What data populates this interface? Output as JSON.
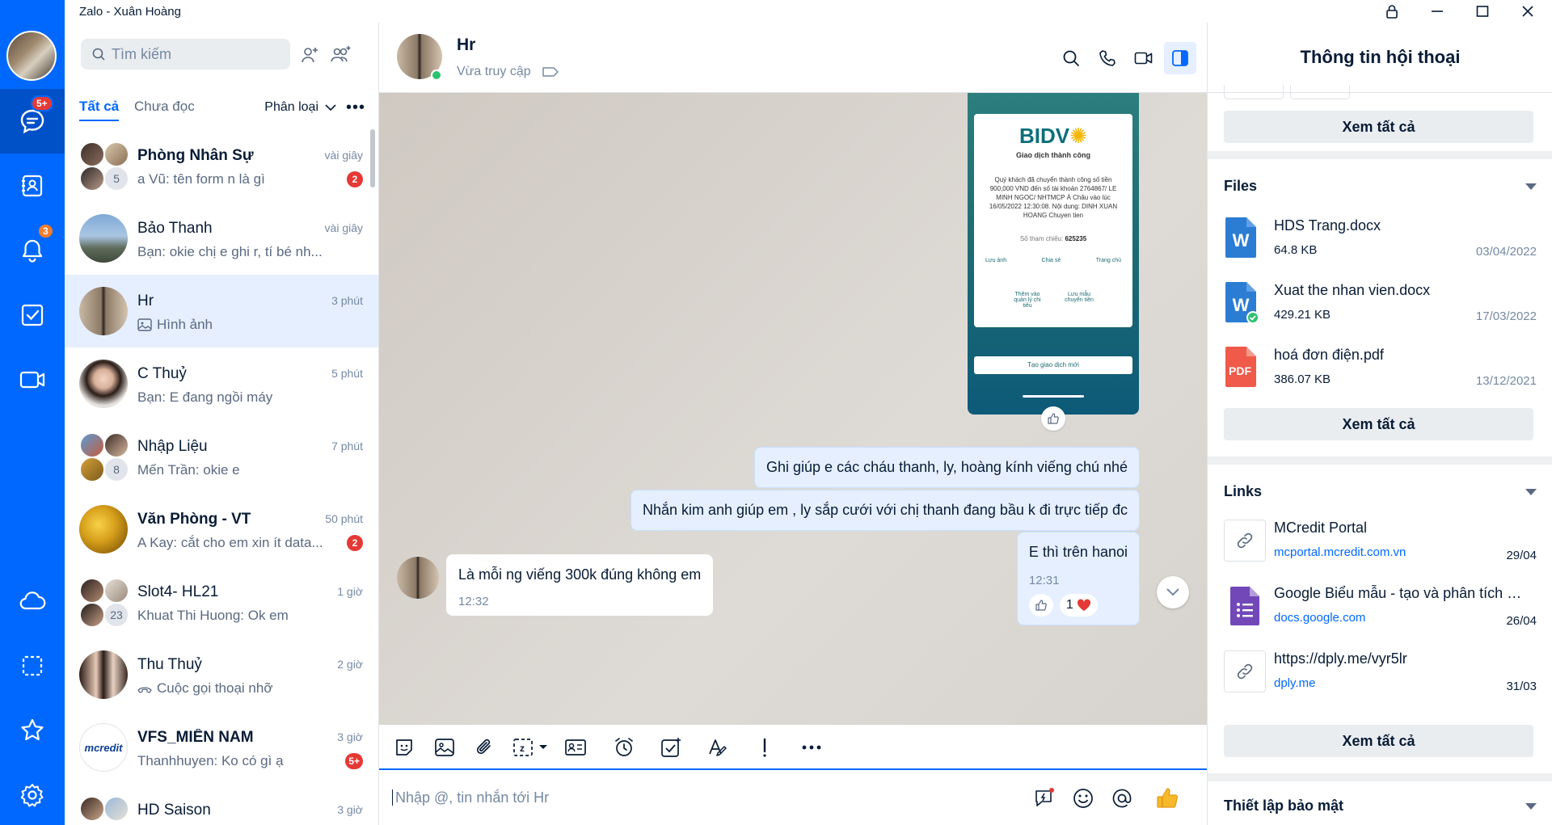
{
  "window": {
    "title": "Zalo - Xuân Hoàng"
  },
  "nav": {
    "chat_badge": "5+",
    "notif_badge": "3"
  },
  "list": {
    "search_placeholder": "Tìm kiếm",
    "tab_all": "Tất cả",
    "tab_unread": "Chưa đọc",
    "filter_label": "Phân loại",
    "more": "•••",
    "conversations": [
      {
        "name": "Phòng Nhân Sự",
        "time": "vài giây",
        "preview": "a Vũ: tên form n là gì",
        "badge": "2",
        "group_count": "5"
      },
      {
        "name": "Bảo Thanh",
        "time": "vài giây",
        "preview": "Bạn: okie chị e ghi r, tí bé nh..."
      },
      {
        "name": "Hr",
        "time": "3 phút",
        "preview": "Hình ảnh"
      },
      {
        "name": "C Thuỷ",
        "time": "5 phút",
        "preview": "Bạn: E đang ngồi máy"
      },
      {
        "name": "Nhập Liệu",
        "time": "7 phút",
        "preview": "Mến Trần: okie e",
        "group_count": "8"
      },
      {
        "name": "Văn Phòng - VT",
        "time": "50 phút",
        "preview": "A Kay: cắt cho em xin ít data...",
        "badge": "2"
      },
      {
        "name": "Slot4- HL21",
        "time": "1 giờ",
        "preview": "Khuat Thi Huong: Ok em",
        "group_count": "23"
      },
      {
        "name": "Thu Thuỷ",
        "time": "2 giờ",
        "preview": "Cuộc gọi thoại nhỡ"
      },
      {
        "name": "VFS_MIỀN NAM",
        "time": "3 giờ",
        "preview": "Thanhhuyen: Ko có gì ạ",
        "badge": "5+",
        "logo_text": "mcredit"
      },
      {
        "name": "HD Saison",
        "time": "3 giờ",
        "preview": ""
      }
    ]
  },
  "chat": {
    "name": "Hr",
    "status": "Vừa truy cập",
    "receipt": {
      "bank": "BIDV",
      "subtitle": "Giao dịch thành công",
      "body": "Quý khách đã chuyển thành công số tiền 900,000 VND đến số tài khoản 2764867/ LE MINH NGOC/ NHTMCP Á Châu vào lúc 16/05/2022 12:30:08. Nội dung: DINH XUAN HOANG Chuyen tien",
      "ref_label": "Số tham chiếu:",
      "ref_value": "625235",
      "action1": "Lưu ảnh",
      "action2": "Chia sẻ",
      "action3": "Trang chủ",
      "action4": "Thêm vào quản lý chi tiêu",
      "action5": "Lưu mẫu chuyển tiền",
      "new_tx": "Tạo giao dịch mới"
    },
    "messages": [
      {
        "text": "Ghi giúp e các cháu thanh, ly, hoàng kính viếng chú nhé"
      },
      {
        "text": "Nhắn kim anh giúp em , ly sắp cưới với chị thanh đang bầu k đi trực tiếp đc"
      },
      {
        "text": "E thì trên hanoi",
        "time": "12:31",
        "reaction_count": "1"
      },
      {
        "text": "Là mỗi ng viếng 300k đúng không em",
        "time": "12:32"
      }
    ],
    "input_placeholder": "Nhập @, tin nhắn tới Hr"
  },
  "info": {
    "title": "Thông tin hội thoại",
    "see_all": "Xem tất cả",
    "files_title": "Files",
    "files": [
      {
        "name": "HDS Trang.docx",
        "size": "64.8 KB",
        "date": "03/04/2022",
        "type": "W"
      },
      {
        "name": "Xuat the nhan vien.docx",
        "size": "429.21 KB",
        "date": "17/03/2022",
        "type": "W"
      },
      {
        "name": "hoá đơn điện.pdf",
        "size": "386.07 KB",
        "date": "13/12/2021",
        "type": "PDF"
      }
    ],
    "links_title": "Links",
    "links": [
      {
        "title": "MCredit Portal",
        "domain": "mcportal.mcredit.com.vn",
        "date": "29/04"
      },
      {
        "title": "Google Biểu mẫu - tạo và phân tích bả...",
        "domain": "docs.google.com",
        "date": "26/04"
      },
      {
        "title": "https://dply.me/vyr5lr",
        "domain": "dply.me",
        "date": "31/03"
      }
    ],
    "security_title": "Thiết lập bảo mật"
  },
  "colors": {
    "brand": "#0068ff",
    "badge": "#e53935",
    "online": "#2bc36f"
  }
}
